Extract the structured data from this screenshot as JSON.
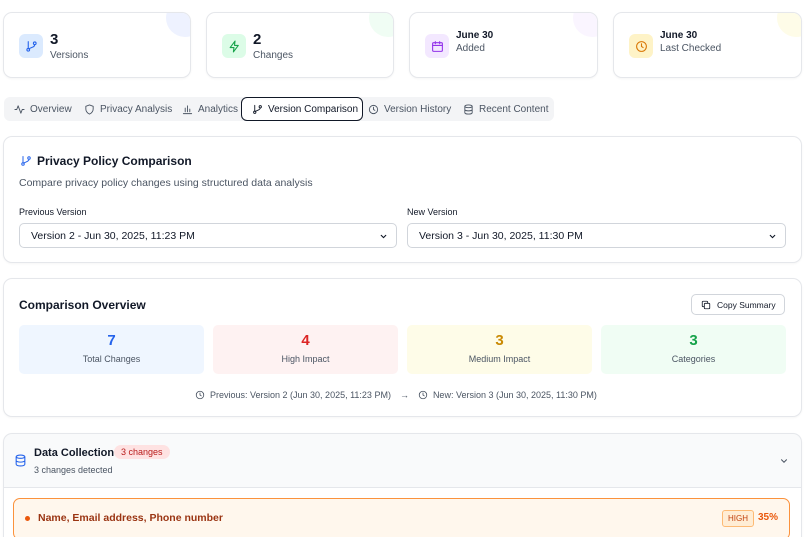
{
  "stats": [
    {
      "value": "3",
      "label": "Versions",
      "icon": "git-branch-icon"
    },
    {
      "value": "2",
      "label": "Changes",
      "icon": "activity-icon"
    },
    {
      "value": "June 30",
      "label": "Added",
      "icon": "calendar-icon"
    },
    {
      "value": "June 30",
      "label": "Last Checked",
      "icon": "clock-icon"
    }
  ],
  "tabs": [
    {
      "label": "Overview",
      "icon": "activity-icon"
    },
    {
      "label": "Privacy Analysis",
      "icon": "shield-icon"
    },
    {
      "label": "Analytics",
      "icon": "bar-chart-icon"
    },
    {
      "label": "Version Comparison",
      "icon": "git-branch-icon",
      "active": true
    },
    {
      "label": "Version History",
      "icon": "clock-icon"
    },
    {
      "label": "Recent Content",
      "icon": "database-icon"
    }
  ],
  "comparison": {
    "title": "Privacy Policy Comparison",
    "subtitle": "Compare privacy policy changes using structured data analysis",
    "previous_label": "Previous Version",
    "previous_value": "Version 2 - Jun 30, 2025, 11:23 PM",
    "new_label": "New Version",
    "new_value": "Version 3 - Jun 30, 2025, 11:30 PM"
  },
  "overview": {
    "title": "Comparison Overview",
    "copy_label": "Copy Summary",
    "metrics": [
      {
        "value": "7",
        "label": "Total Changes",
        "color": "#2563eb",
        "bg": "#eff6ff"
      },
      {
        "value": "4",
        "label": "High Impact",
        "color": "#dc2626",
        "bg": "#fef2f2"
      },
      {
        "value": "3",
        "label": "Medium Impact",
        "color": "#ca8a04",
        "bg": "#fefce8"
      },
      {
        "value": "3",
        "label": "Categories",
        "color": "#16a34a",
        "bg": "#f0fdf4"
      }
    ],
    "previous_text": "Previous: Version 2 (Jun 30, 2025, 11:23 PM)",
    "arrow": "→",
    "new_text": "New: Version 3 (Jun 30, 2025, 11:30 PM)"
  },
  "category": {
    "title": "Data Collection",
    "badge": "3 changes",
    "subtitle": "3 changes detected"
  },
  "change": {
    "text": "Name, Email address, Phone number",
    "severity": "HIGH",
    "percent": "35%"
  }
}
